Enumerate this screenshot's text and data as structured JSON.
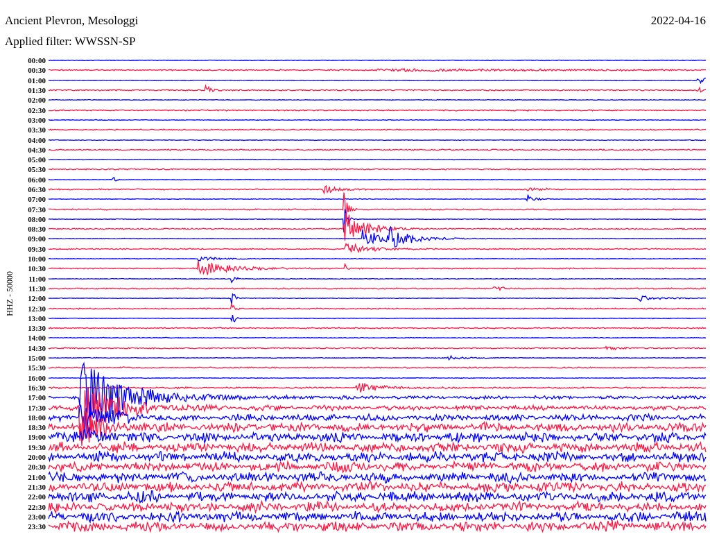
{
  "header": {
    "station": "Ancient Plevron, Mesologgi",
    "date": "2022-04-16",
    "filter": "Applied filter: WWSSN-SP"
  },
  "plot": {
    "axis_label": "HHZ - 50000",
    "rows": [
      {
        "time": "00:00",
        "color": "#0000ff"
      },
      {
        "time": "00:30",
        "color": "#ff1744"
      },
      {
        "time": "01:00",
        "color": "#0000ff"
      },
      {
        "time": "01:30",
        "color": "#ff1744"
      },
      {
        "time": "02:00",
        "color": "#0000ff"
      },
      {
        "time": "02:30",
        "color": "#ff1744"
      },
      {
        "time": "03:00",
        "color": "#0000ff"
      },
      {
        "time": "03:30",
        "color": "#ff1744"
      },
      {
        "time": "04:00",
        "color": "#0000ff"
      },
      {
        "time": "04:30",
        "color": "#ff1744"
      },
      {
        "time": "05:00",
        "color": "#0000ff"
      },
      {
        "time": "05:30",
        "color": "#ff1744"
      },
      {
        "time": "06:00",
        "color": "#0000ff"
      },
      {
        "time": "06:30",
        "color": "#ff1744"
      },
      {
        "time": "07:00",
        "color": "#0000ff"
      },
      {
        "time": "07:30",
        "color": "#ff1744"
      },
      {
        "time": "08:00",
        "color": "#0000ff"
      },
      {
        "time": "08:30",
        "color": "#ff1744"
      },
      {
        "time": "09:00",
        "color": "#0000ff"
      },
      {
        "time": "09:30",
        "color": "#ff1744"
      },
      {
        "time": "10:00",
        "color": "#0000ff"
      },
      {
        "time": "10:30",
        "color": "#ff1744"
      },
      {
        "time": "11:00",
        "color": "#0000ff"
      },
      {
        "time": "11:30",
        "color": "#ff1744"
      },
      {
        "time": "12:00",
        "color": "#0000ff"
      },
      {
        "time": "12:30",
        "color": "#ff1744"
      },
      {
        "time": "13:00",
        "color": "#0000ff"
      },
      {
        "time": "13:30",
        "color": "#ff1744"
      },
      {
        "time": "14:00",
        "color": "#0000ff"
      },
      {
        "time": "14:30",
        "color": "#ff1744"
      },
      {
        "time": "15:00",
        "color": "#0000ff"
      },
      {
        "time": "15:30",
        "color": "#ff1744"
      },
      {
        "time": "16:00",
        "color": "#0000ff"
      },
      {
        "time": "16:30",
        "color": "#ff1744"
      },
      {
        "time": "17:00",
        "color": "#0000ff"
      },
      {
        "time": "17:30",
        "color": "#ff1744"
      },
      {
        "time": "18:00",
        "color": "#0000ff"
      },
      {
        "time": "18:30",
        "color": "#ff1744"
      },
      {
        "time": "19:00",
        "color": "#0000ff"
      },
      {
        "time": "19:30",
        "color": "#ff1744"
      },
      {
        "time": "20:00",
        "color": "#0000ff"
      },
      {
        "time": "20:30",
        "color": "#ff1744"
      },
      {
        "time": "21:00",
        "color": "#0000ff"
      },
      {
        "time": "21:30",
        "color": "#ff1744"
      },
      {
        "time": "22:00",
        "color": "#0000ff"
      },
      {
        "time": "22:30",
        "color": "#ff1744"
      },
      {
        "time": "23:00",
        "color": "#0000ff"
      },
      {
        "time": "23:30",
        "color": "#ff1744"
      }
    ]
  }
}
